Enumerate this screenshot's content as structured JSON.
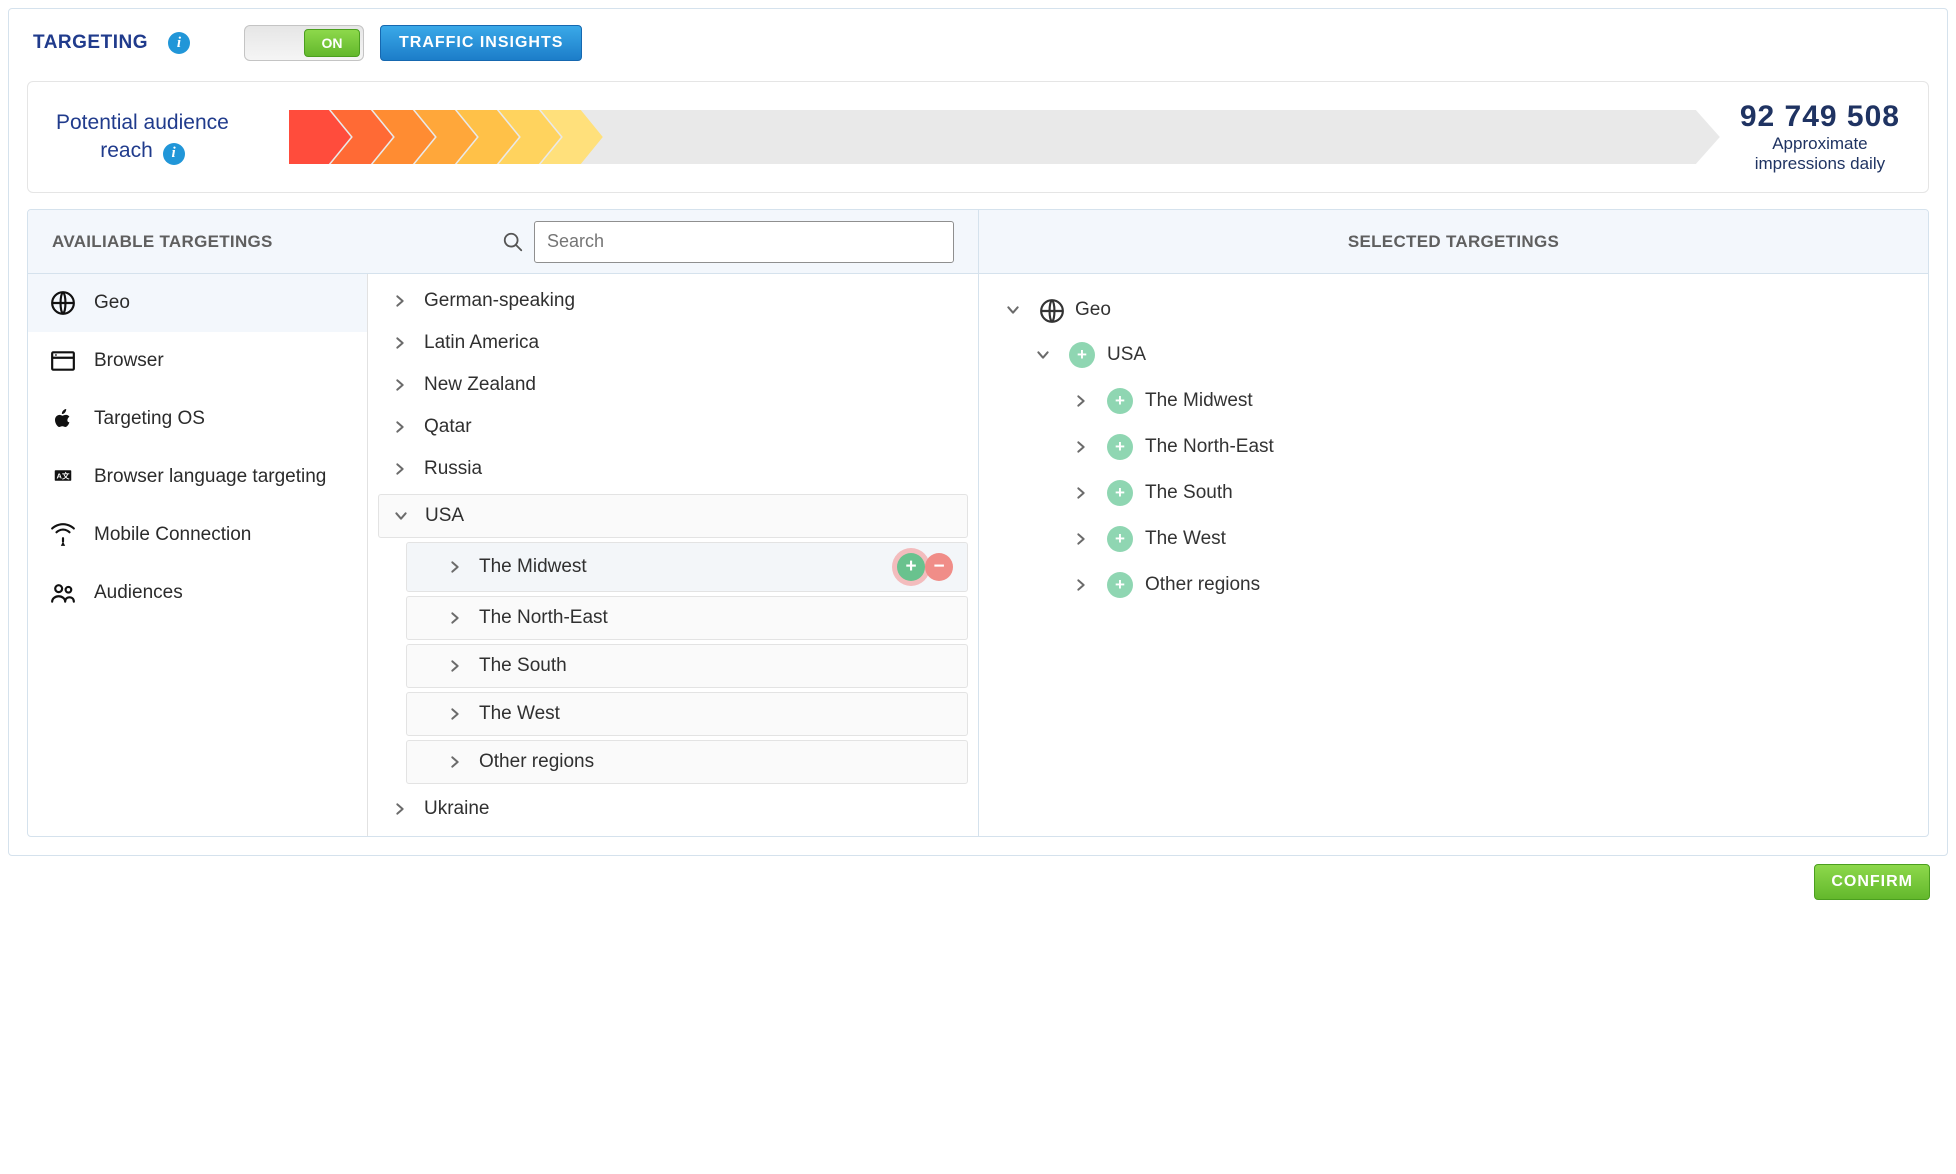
{
  "header": {
    "title": "TARGETING",
    "toggle_label": "ON",
    "traffic_btn": "TRAFFIC INSIGHTS"
  },
  "reach": {
    "label_line1": "Potential audience",
    "label_line2": "reach",
    "number": "92 749 508",
    "sub1": "Approximate",
    "sub2": "impressions daily"
  },
  "left_header": "AVAILIABLE TARGETINGS",
  "right_header": "SELECTED TARGETINGS",
  "search_placeholder": "Search",
  "categories": [
    {
      "label": "Geo",
      "icon": "globe",
      "active": true
    },
    {
      "label": "Browser",
      "icon": "browser"
    },
    {
      "label": "Targeting OS",
      "icon": "apple"
    },
    {
      "label": "Browser language targeting",
      "icon": "lang"
    },
    {
      "label": "Mobile Connection",
      "icon": "signal"
    },
    {
      "label": "Audiences",
      "icon": "people"
    }
  ],
  "tree": {
    "top": [
      {
        "label": "German-speaking"
      },
      {
        "label": "Latin America"
      },
      {
        "label": "New Zealand"
      },
      {
        "label": "Qatar"
      },
      {
        "label": "Russia"
      }
    ],
    "expanded": {
      "label": "USA",
      "children": [
        {
          "label": "The Midwest",
          "hover": true
        },
        {
          "label": "The North-East"
        },
        {
          "label": "The South"
        },
        {
          "label": "The West"
        },
        {
          "label": "Other regions"
        }
      ]
    },
    "after": [
      {
        "label": "Ukraine"
      }
    ]
  },
  "selected": {
    "root": {
      "label": "Geo"
    },
    "country": {
      "label": "USA"
    },
    "regions": [
      {
        "label": "The Midwest"
      },
      {
        "label": "The North-East"
      },
      {
        "label": "The South"
      },
      {
        "label": "The West"
      },
      {
        "label": "Other regions"
      }
    ]
  },
  "confirm_label": "CONFIRM"
}
